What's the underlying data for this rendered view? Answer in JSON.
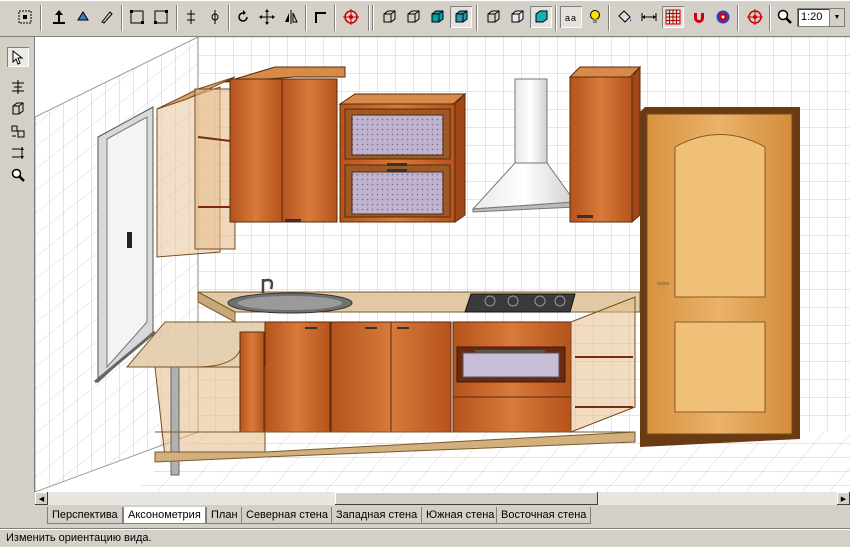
{
  "toolbar": {
    "zoom_value": "1:20",
    "buttons": [
      {
        "icon": "select-all-icon"
      },
      {
        "icon": "move-up-icon"
      },
      {
        "icon": "rotate-icon"
      },
      {
        "icon": "edit-icon"
      },
      {
        "icon": "frame-icon"
      },
      {
        "icon": "frame-select-icon"
      },
      {
        "icon": "align-vertical-icon"
      },
      {
        "icon": "align-center-icon"
      },
      {
        "icon": "rotate-view-icon"
      },
      {
        "icon": "move-view-icon"
      },
      {
        "icon": "mirror-icon"
      },
      {
        "icon": "corner-icon"
      },
      {
        "icon": "target-icon"
      },
      {
        "icon": "cube-front-icon"
      },
      {
        "icon": "cube-wire-icon"
      },
      {
        "icon": "cube-shaded-icon"
      },
      {
        "icon": "cube-textured-icon"
      },
      {
        "icon": "box-outline-icon"
      },
      {
        "icon": "box-hidden-icon"
      },
      {
        "icon": "box-solid-icon"
      },
      {
        "icon": "text-labels-icon"
      },
      {
        "icon": "light-bulb-icon"
      },
      {
        "icon": "bucket-icon"
      },
      {
        "icon": "dimension-icon"
      },
      {
        "icon": "grid-icon"
      },
      {
        "icon": "magnet-icon"
      },
      {
        "icon": "snap-target-icon"
      },
      {
        "icon": "crosshair-icon"
      },
      {
        "icon": "zoom-icon"
      }
    ]
  },
  "left_tools": [
    {
      "icon": "pointer-icon"
    },
    {
      "icon": "light-source-icon"
    },
    {
      "icon": "box-icon"
    },
    {
      "icon": "objects-icon"
    },
    {
      "icon": "distribute-icon"
    },
    {
      "icon": "magnifier-icon"
    }
  ],
  "tabs": [
    {
      "label": "Перспектива",
      "active": false
    },
    {
      "label": "Аксонометрия",
      "active": true
    },
    {
      "label": "План",
      "active": false
    },
    {
      "label": "Северная стена",
      "active": false
    },
    {
      "label": "Западная стена",
      "active": false
    },
    {
      "label": "Южная стена",
      "active": false
    },
    {
      "label": "Восточная стена",
      "active": false
    }
  ],
  "status_text": "Изменить ориентацию вида.",
  "colors": {
    "wood": "#c8652a",
    "wood_dark": "#8a3c14",
    "door": "#e2a55a",
    "glass": "#b9a9c9",
    "tile_line": "#b8b8b8"
  }
}
